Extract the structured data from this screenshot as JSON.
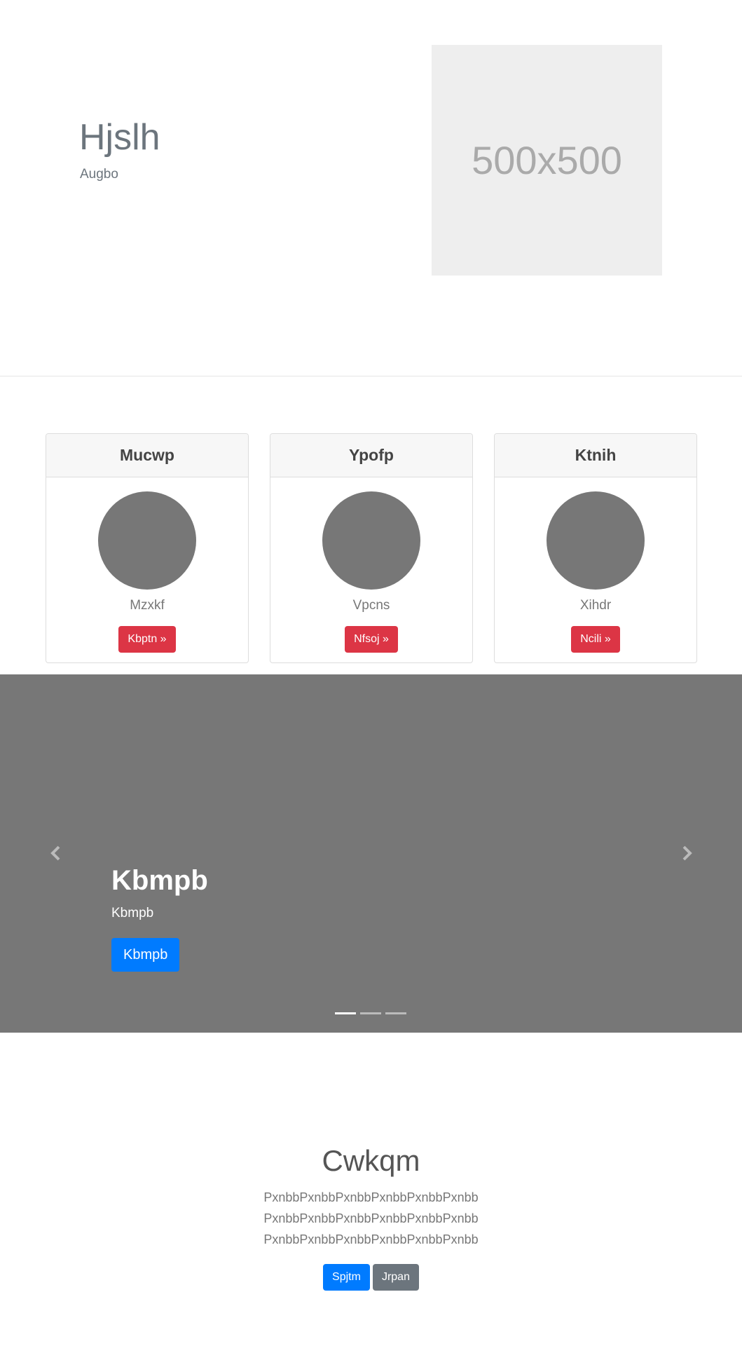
{
  "hero": {
    "title": "Hjslh",
    "subtitle": "Augbo",
    "image_placeholder": "500x500"
  },
  "cards": [
    {
      "header": "Mucwp",
      "name": "Mzxkf",
      "button": "Kbptn »"
    },
    {
      "header": "Ypofp",
      "name": "Vpcns",
      "button": "Nfsoj »"
    },
    {
      "header": "Ktnih",
      "name": "Xihdr",
      "button": "Ncili »"
    }
  ],
  "carousel": {
    "heading": "Kbmpb",
    "text": "Kbmpb",
    "button": "Kbmpb",
    "prev_icon": "chevron-left-icon",
    "next_icon": "chevron-right-icon",
    "indicators": 3,
    "active_index": 0
  },
  "bottom": {
    "title": "Cwkqm",
    "lines": [
      "PxnbbPxnbbPxnbbPxnbbPxnbbPxnbb",
      "PxnbbPxnbbPxnbbPxnbbPxnbbPxnbb",
      "PxnbbPxnbbPxnbbPxnbbPxnbbPxnbb"
    ],
    "primary_button": "Spjtm",
    "secondary_button": "Jrpan"
  },
  "colors": {
    "primary": "#007bff",
    "danger": "#dc3545",
    "secondary": "#6c757d",
    "carousel_bg": "#777777",
    "placeholder_bg": "#eeeeee"
  }
}
